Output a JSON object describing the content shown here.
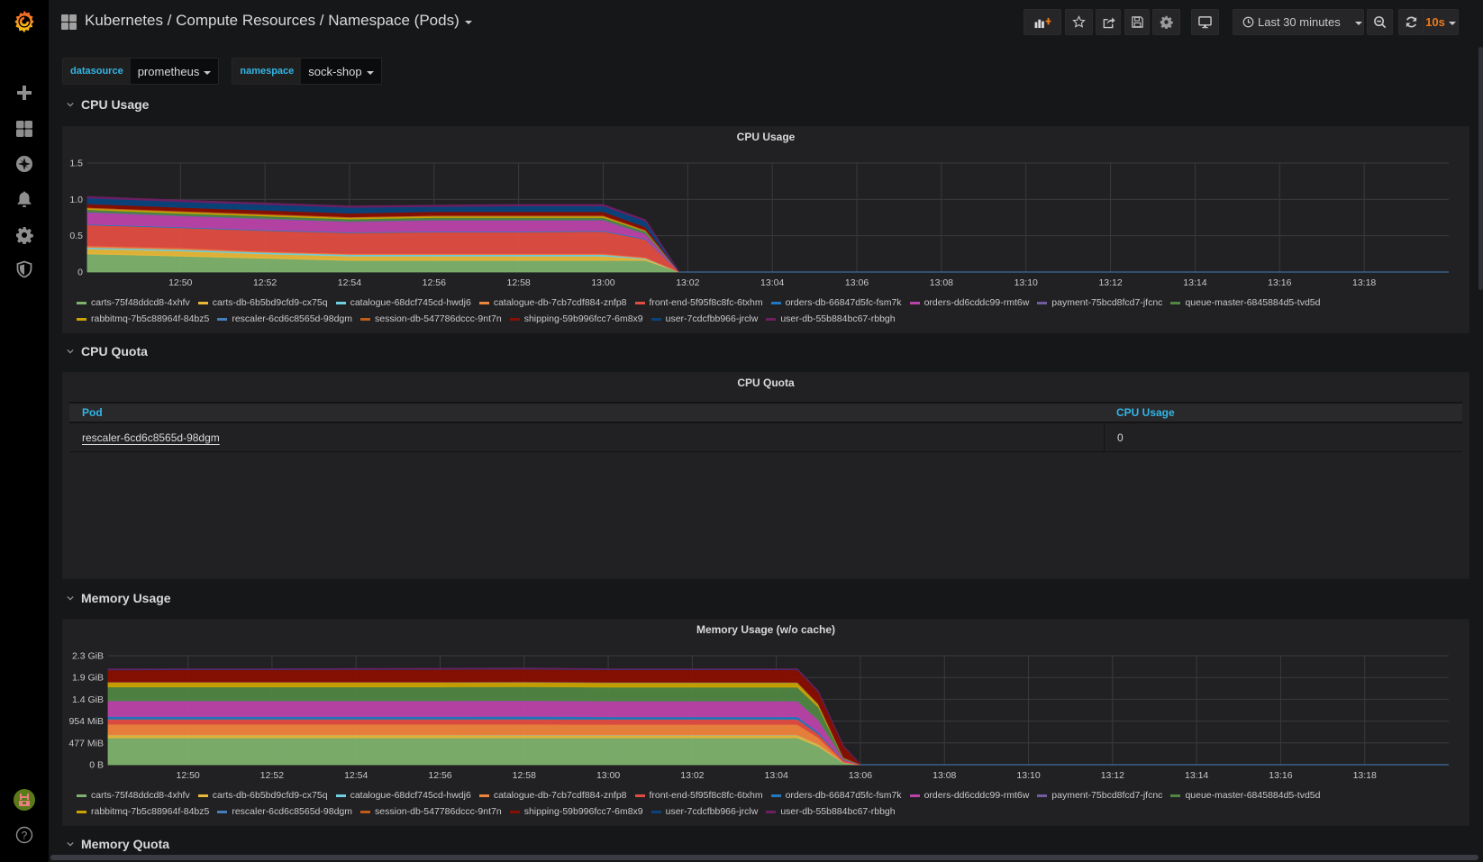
{
  "header": {
    "title": "Kubernetes / Compute Resources / Namespace (Pods)",
    "time_range": "Last 30 minutes",
    "refresh_interval": "10s",
    "accent_color": "#eb7b18"
  },
  "sidebar": {
    "items": [
      {
        "icon": "plus-icon",
        "label": "Create"
      },
      {
        "icon": "dashboards-icon",
        "label": "Dashboards"
      },
      {
        "icon": "explore-compass-icon",
        "label": "Explore"
      },
      {
        "icon": "bell-icon",
        "label": "Alerting"
      },
      {
        "icon": "gear-icon",
        "label": "Configuration"
      },
      {
        "icon": "shield-icon",
        "label": "Server Admin"
      }
    ]
  },
  "toolbar": {
    "buttons": [
      "add-panel",
      "star",
      "share",
      "save",
      "settings",
      "cycle-view",
      "time-picker",
      "zoom-out",
      "refresh"
    ]
  },
  "variables": [
    {
      "label": "datasource",
      "value": "prometheus"
    },
    {
      "label": "namespace",
      "value": "sock-shop"
    }
  ],
  "rows": {
    "cpu_usage": "CPU Usage",
    "cpu_quota": "CPU Quota",
    "memory_usage": "Memory Usage",
    "memory_quota": "Memory Quota"
  },
  "series": [
    {
      "name": "carts-75f48ddcd8-4xhfv",
      "color": "#7eb26d"
    },
    {
      "name": "carts-db-6b5bd9cfd9-cx75q",
      "color": "#eab839"
    },
    {
      "name": "catalogue-68dcf745cd-hwdj6",
      "color": "#6ed0e0"
    },
    {
      "name": "catalogue-db-7cb7cdf884-znfp8",
      "color": "#ef843c"
    },
    {
      "name": "front-end-5f95f8c8fc-6txhm",
      "color": "#e24d42"
    },
    {
      "name": "orders-db-66847d5fc-fsm7k",
      "color": "#1f78c1"
    },
    {
      "name": "orders-dd6cddc99-rmt6w",
      "color": "#ba43a9"
    },
    {
      "name": "payment-75bcd8fcd7-jfcnc",
      "color": "#705da0"
    },
    {
      "name": "queue-master-6845884d5-tvd5d",
      "color": "#508642"
    },
    {
      "name": "rabbitmq-7b5c88964f-84bz5",
      "color": "#cca300"
    },
    {
      "name": "rescaler-6cd6c8565d-98dgm",
      "color": "#447ebc"
    },
    {
      "name": "session-db-547786dccc-9nt7n",
      "color": "#c15c17"
    },
    {
      "name": "shipping-59b996fcc7-6m8x9",
      "color": "#890f02"
    },
    {
      "name": "user-7cdcfbb966-jrclw",
      "color": "#0a437c"
    },
    {
      "name": "user-db-55b884bc67-rbbgh",
      "color": "#6d1f62"
    }
  ],
  "chart_data": [
    {
      "type": "area",
      "stacked": true,
      "title": "CPU Usage",
      "xlabel": "",
      "ylabel": "",
      "x_ticks": [
        "12:50",
        "12:52",
        "12:54",
        "12:56",
        "12:58",
        "13:00",
        "13:02",
        "13:04",
        "13:06",
        "13:08",
        "13:10",
        "13:12",
        "13:14",
        "13:16",
        "13:18"
      ],
      "x_range_minutes": [
        -2.2,
        30
      ],
      "y_ticks": [
        "0",
        "0.5",
        "1.0",
        "1.5"
      ],
      "ylim": [
        0,
        1.5
      ],
      "grid": true,
      "legend": "bottom",
      "x_minutes": [
        -2.2,
        0,
        2,
        4,
        6,
        8,
        10,
        11,
        11.8
      ],
      "series": [
        {
          "name": "carts-75f48ddcd8-4xhfv",
          "values": [
            0.25,
            0.22,
            0.19,
            0.16,
            0.16,
            0.16,
            0.16,
            0.16,
            0.0
          ]
        },
        {
          "name": "carts-db-6b5bd9cfd9-cx75q",
          "values": [
            0.07,
            0.07,
            0.06,
            0.06,
            0.06,
            0.06,
            0.06,
            0.02,
            0.0
          ]
        },
        {
          "name": "catalogue-68dcf745cd-hwdj6",
          "values": [
            0.02,
            0.02,
            0.02,
            0.02,
            0.02,
            0.02,
            0.02,
            0.01,
            0.0
          ]
        },
        {
          "name": "catalogue-db-7cb7cdf884-znfp8",
          "values": [
            0.02,
            0.02,
            0.01,
            0.01,
            0.01,
            0.01,
            0.01,
            0.01,
            0.0
          ]
        },
        {
          "name": "front-end-5f95f8c8fc-6txhm",
          "values": [
            0.29,
            0.28,
            0.29,
            0.29,
            0.3,
            0.3,
            0.31,
            0.25,
            0.0
          ]
        },
        {
          "name": "orders-db-66847d5fc-fsm7k",
          "values": [
            0.01,
            0.01,
            0.01,
            0.01,
            0.01,
            0.01,
            0.01,
            0.01,
            0.0
          ]
        },
        {
          "name": "orders-dd6cddc99-rmt6w",
          "values": [
            0.16,
            0.15,
            0.15,
            0.14,
            0.15,
            0.15,
            0.14,
            0.06,
            0.0
          ]
        },
        {
          "name": "payment-75bcd8fcd7-jfcnc",
          "values": [
            0.01,
            0.01,
            0.01,
            0.01,
            0.01,
            0.01,
            0.01,
            0.01,
            0.0
          ]
        },
        {
          "name": "queue-master-6845884d5-tvd5d",
          "values": [
            0.03,
            0.03,
            0.03,
            0.03,
            0.03,
            0.03,
            0.03,
            0.03,
            0.0
          ]
        },
        {
          "name": "rabbitmq-7b5c88964f-84bz5",
          "values": [
            0.02,
            0.02,
            0.02,
            0.02,
            0.02,
            0.02,
            0.02,
            0.01,
            0.0
          ]
        },
        {
          "name": "rescaler-6cd6c8565d-98dgm",
          "values": [
            0.0,
            0.0,
            0.0,
            0.0,
            0.0,
            0.0,
            0.0,
            0.0,
            0.0
          ]
        },
        {
          "name": "session-db-547786dccc-9nt7n",
          "values": [
            0.01,
            0.01,
            0.01,
            0.01,
            0.01,
            0.01,
            0.01,
            0.01,
            0.0
          ]
        },
        {
          "name": "shipping-59b996fcc7-6m8x9",
          "values": [
            0.05,
            0.05,
            0.05,
            0.05,
            0.05,
            0.05,
            0.05,
            0.04,
            0.0
          ]
        },
        {
          "name": "user-7cdcfbb966-jrclw",
          "values": [
            0.08,
            0.08,
            0.08,
            0.08,
            0.07,
            0.08,
            0.08,
            0.08,
            0.0
          ]
        },
        {
          "name": "user-db-55b884bc67-rbbgh",
          "values": [
            0.02,
            0.02,
            0.02,
            0.02,
            0.02,
            0.02,
            0.02,
            0.02,
            0.0
          ]
        }
      ]
    },
    {
      "type": "table",
      "title": "CPU Quota",
      "columns": [
        "Pod",
        "CPU Usage"
      ],
      "rows": [
        [
          "rescaler-6cd6c8565d-98dgm",
          "0"
        ]
      ]
    },
    {
      "type": "area",
      "stacked": true,
      "title": "Memory Usage (w/o cache)",
      "xlabel": "",
      "ylabel": "",
      "x_ticks": [
        "12:50",
        "12:52",
        "12:54",
        "12:56",
        "12:58",
        "13:00",
        "13:02",
        "13:04",
        "13:06",
        "13:08",
        "13:10",
        "13:12",
        "13:14",
        "13:16",
        "13:18"
      ],
      "x_range_minutes": [
        -1.9,
        30
      ],
      "y_ticks": [
        "0 B",
        "477 MiB",
        "954 MiB",
        "1.4 GiB",
        "1.9 GiB",
        "2.3 GiB"
      ],
      "ylim_mib": [
        0,
        2385
      ],
      "grid": true,
      "legend": "bottom",
      "x_minutes": [
        -1.9,
        0,
        2,
        4,
        6,
        8,
        10,
        12,
        14.5,
        15,
        15.6,
        16
      ],
      "series": [
        {
          "name": "carts-75f48ddcd8-4xhfv",
          "values": [
            590,
            590,
            590,
            590,
            590,
            590,
            590,
            590,
            590,
            400,
            40,
            0
          ]
        },
        {
          "name": "carts-db-6b5bd9cfd9-cx75q",
          "values": [
            60,
            60,
            60,
            60,
            60,
            55,
            55,
            55,
            55,
            40,
            5,
            0
          ]
        },
        {
          "name": "catalogue-68dcf745cd-hwdj6",
          "values": [
            5,
            5,
            5,
            5,
            5,
            5,
            5,
            5,
            5,
            5,
            2,
            0
          ]
        },
        {
          "name": "catalogue-db-7cb7cdf884-znfp8",
          "values": [
            230,
            230,
            230,
            230,
            230,
            235,
            230,
            230,
            230,
            150,
            10,
            0
          ]
        },
        {
          "name": "front-end-5f95f8c8fc-6txhm",
          "values": [
            115,
            115,
            115,
            115,
            115,
            115,
            115,
            115,
            115,
            80,
            40,
            10
          ]
        },
        {
          "name": "orders-db-66847d5fc-fsm7k",
          "values": [
            55,
            55,
            55,
            55,
            55,
            60,
            55,
            55,
            55,
            40,
            5,
            0
          ]
        },
        {
          "name": "orders-dd6cddc99-rmt6w",
          "values": [
            340,
            340,
            340,
            340,
            340,
            340,
            340,
            340,
            340,
            260,
            20,
            0
          ]
        },
        {
          "name": "payment-75bcd8fcd7-jfcnc",
          "values": [
            8,
            8,
            8,
            8,
            8,
            8,
            8,
            8,
            8,
            8,
            2,
            0
          ]
        },
        {
          "name": "queue-master-6845884d5-tvd5d",
          "values": [
            300,
            300,
            300,
            300,
            300,
            300,
            300,
            300,
            300,
            280,
            20,
            0
          ]
        },
        {
          "name": "rabbitmq-7b5c88964f-84bz5",
          "values": [
            100,
            100,
            100,
            100,
            100,
            100,
            100,
            100,
            100,
            60,
            10,
            0
          ]
        },
        {
          "name": "rescaler-6cd6c8565d-98dgm",
          "values": [
            5,
            5,
            5,
            5,
            5,
            5,
            5,
            5,
            5,
            5,
            2,
            0
          ]
        },
        {
          "name": "session-db-547786dccc-9nt7n",
          "values": [
            5,
            5,
            5,
            5,
            5,
            5,
            5,
            5,
            5,
            5,
            2,
            0
          ]
        },
        {
          "name": "shipping-59b996fcc7-6m8x9",
          "values": [
            260,
            265,
            265,
            270,
            275,
            275,
            270,
            270,
            270,
            260,
            240,
            0
          ]
        },
        {
          "name": "user-7cdcfbb966-jrclw",
          "values": [
            10,
            10,
            10,
            10,
            10,
            10,
            10,
            10,
            10,
            10,
            5,
            0
          ]
        },
        {
          "name": "user-db-55b884bc67-rbbgh",
          "values": [
            12,
            12,
            12,
            12,
            12,
            12,
            12,
            12,
            12,
            10,
            5,
            0
          ]
        }
      ]
    }
  ]
}
